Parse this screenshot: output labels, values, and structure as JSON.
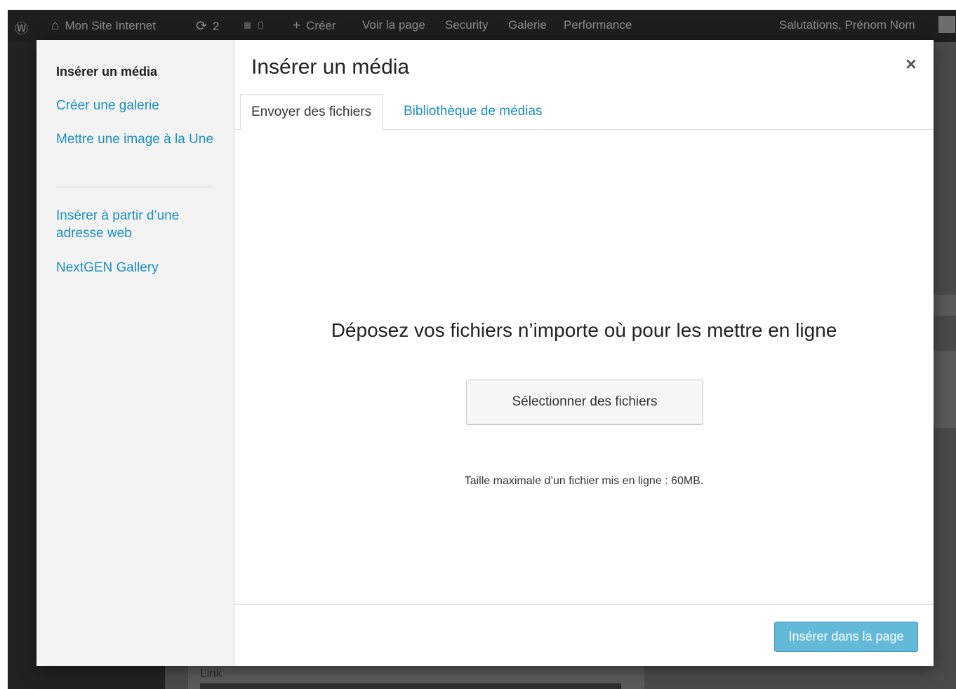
{
  "adminbar": {
    "site_name": "Mon Site Internet",
    "updates_count": "2",
    "comments_count": "0",
    "create": "Créer",
    "view_page": "Voir la page",
    "security": "Security",
    "gallery": "Galerie",
    "performance": "Performance",
    "greeting": "Salutations, Prénom Nom"
  },
  "background": {
    "link_label": "Link"
  },
  "menu": {
    "items": [
      {
        "label": "Insérer un média"
      },
      {
        "label": "Créer une galerie"
      },
      {
        "label": "Mettre une image à la Une"
      },
      {
        "label": "Insérer à partir d’une adresse web"
      },
      {
        "label": "NextGEN Gallery"
      }
    ]
  },
  "modal": {
    "title": "Insérer un média",
    "close_symbol": "×",
    "tabs": [
      {
        "label": "Envoyer des fichiers",
        "active": true
      },
      {
        "label": "Bibliothèque de médias",
        "active": false
      }
    ],
    "drop_text": "Déposez vos fichiers n’importe où pour les mettre en ligne",
    "select_button": "Sélectionner des fichiers",
    "max_size": "Taille maximale d’un fichier mis en ligne : 60MB.",
    "insert_button": "Insérer dans la page"
  },
  "colors": {
    "accent": "#1a8fc4",
    "button_primary": "#2ea2cc",
    "adminbar_bg": "#1e1e1e"
  }
}
